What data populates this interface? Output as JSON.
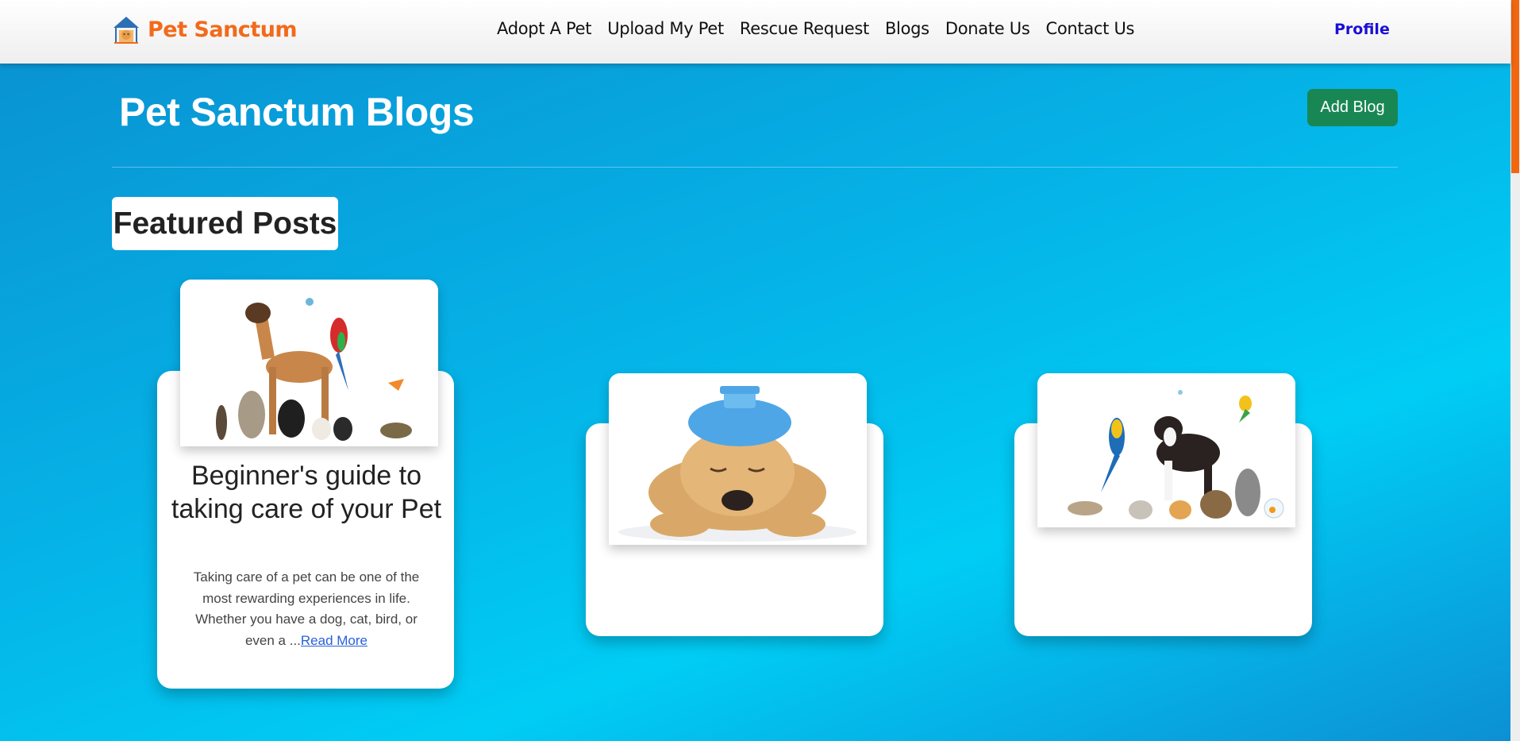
{
  "brand": {
    "name": "Pet Sanctum",
    "logo_icon": "pet-house-icon"
  },
  "nav": {
    "links": [
      "Adopt A Pet",
      "Upload My Pet",
      "Rescue Request",
      "Blogs",
      "Donate Us",
      "Contact Us"
    ],
    "profile": "Profile"
  },
  "header": {
    "title": "Pet Sanctum Blogs",
    "add_blog_label": "Add Blog"
  },
  "featured": {
    "label": "Featured Posts",
    "posts": [
      {
        "title": "Beginner's guide to taking care of your Pet",
        "excerpt": "Taking care of a pet can be one of the most rewarding experiences in life. Whether you have a dog, cat, bird, or even a ...",
        "read_more": "Read More",
        "image": "pets-group-photo"
      },
      {
        "title": "",
        "excerpt": "",
        "image": "sick-puppy-ice-bag-photo"
      },
      {
        "title": "",
        "excerpt": "",
        "image": "pets-group-photo"
      }
    ]
  },
  "colors": {
    "brand": "#f26a1b",
    "profile": "#1a10d6",
    "add_blog": "#198754",
    "background": "#05b4e8",
    "scroll_thumb": "#f2660f"
  }
}
